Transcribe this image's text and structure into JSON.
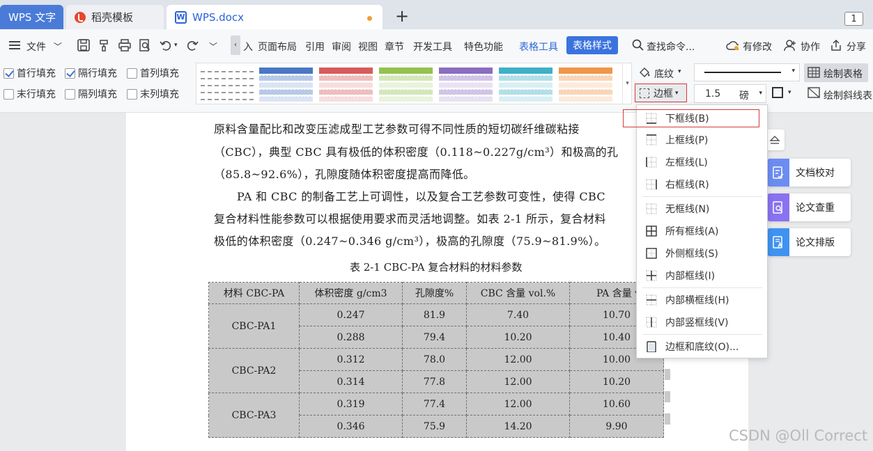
{
  "tabs": {
    "app": "WPS 文字",
    "template": "稻壳模板",
    "document": "WPS.docx",
    "new_tab": "+",
    "page_count": "1"
  },
  "menu": {
    "file": "文件",
    "items": [
      "入",
      "页面布局",
      "引用",
      "审阅",
      "视图",
      "章节",
      "开发工具",
      "特色功能"
    ],
    "table_tools": "表格工具",
    "table_style": "表格样式",
    "search": "查找命令...",
    "modified": "有修改",
    "collaborate": "协作",
    "share": "分享"
  },
  "ribbon": {
    "checkboxes": [
      {
        "label": "首行填充",
        "checked": true
      },
      {
        "label": "隔行填充",
        "checked": true
      },
      {
        "label": "首列填充",
        "checked": false
      },
      {
        "label": "末行填充",
        "checked": false
      },
      {
        "label": "隔列填充",
        "checked": false
      },
      {
        "label": "末列填充",
        "checked": false
      }
    ],
    "shading": "底纹",
    "border": "边框",
    "line_width": "1.5",
    "line_unit": "磅",
    "draw_table": "绘制表格",
    "draw_diagonal": "绘制斜线表",
    "style_colors": [
      "#ffffff",
      "#4a77c4",
      "#d85b5b",
      "#93c24f",
      "#8a6dc0",
      "#3fb0c8",
      "#f0954a"
    ]
  },
  "document": {
    "paragraphs": [
      "原料含量配比和改变压滤成型工艺参数可得不同性质的短切碳纤维碳粘接",
      "（CBC），典型 CBC 具有极低的体积密度（0.118~0.227g/cm³）和极高的孔",
      "（85.8~92.6%），孔隙度随体积密度提高而降低。",
      "PA 和 CBC 的制备工艺上可调性，以及复合工艺参数可变性，使得 CBC",
      "复合材料性能参数可以根据使用要求而灵活地调整。如表 2-1 所示，复合材料",
      "极低的体积密度（0.247~0.346 g/cm³），极高的孔隙度（75.9~81.9%）。"
    ],
    "caption": "表 2-1 CBC-PA 复合材料的材料参数",
    "table": {
      "headers": [
        "材料 CBC-PA",
        "体积密度 g/cm3",
        "孔隙度%",
        "CBC 含量 vol.%",
        "PA 含量 vo"
      ],
      "groups": [
        {
          "material": "CBC-PA1",
          "rows": [
            [
              "0.247",
              "81.9",
              "7.40",
              "10.70"
            ],
            [
              "0.288",
              "79.4",
              "10.20",
              "10.40"
            ]
          ]
        },
        {
          "material": "CBC-PA2",
          "rows": [
            [
              "0.312",
              "78.0",
              "12.00",
              "10.00"
            ],
            [
              "0.314",
              "77.8",
              "12.00",
              "10.20"
            ]
          ]
        },
        {
          "material": "CBC-PA3",
          "rows": [
            [
              "0.319",
              "77.4",
              "12.00",
              "10.60"
            ],
            [
              "0.346",
              "75.9",
              "14.20",
              "9.90"
            ]
          ]
        }
      ]
    }
  },
  "dropdown": {
    "items": [
      "下框线(B)",
      "上框线(P)",
      "左框线(L)",
      "右框线(R)",
      "无框线(N)",
      "所有框线(A)",
      "外侧框线(S)",
      "内部框线(I)",
      "内部横框线(H)",
      "内部竖框线(V)",
      "边框和底纹(O)..."
    ]
  },
  "side_panel": {
    "proofread": "文档校对",
    "plagiarism": "论文查重",
    "layout": "论文排版"
  },
  "watermark": "CSDN @Oll Correct"
}
